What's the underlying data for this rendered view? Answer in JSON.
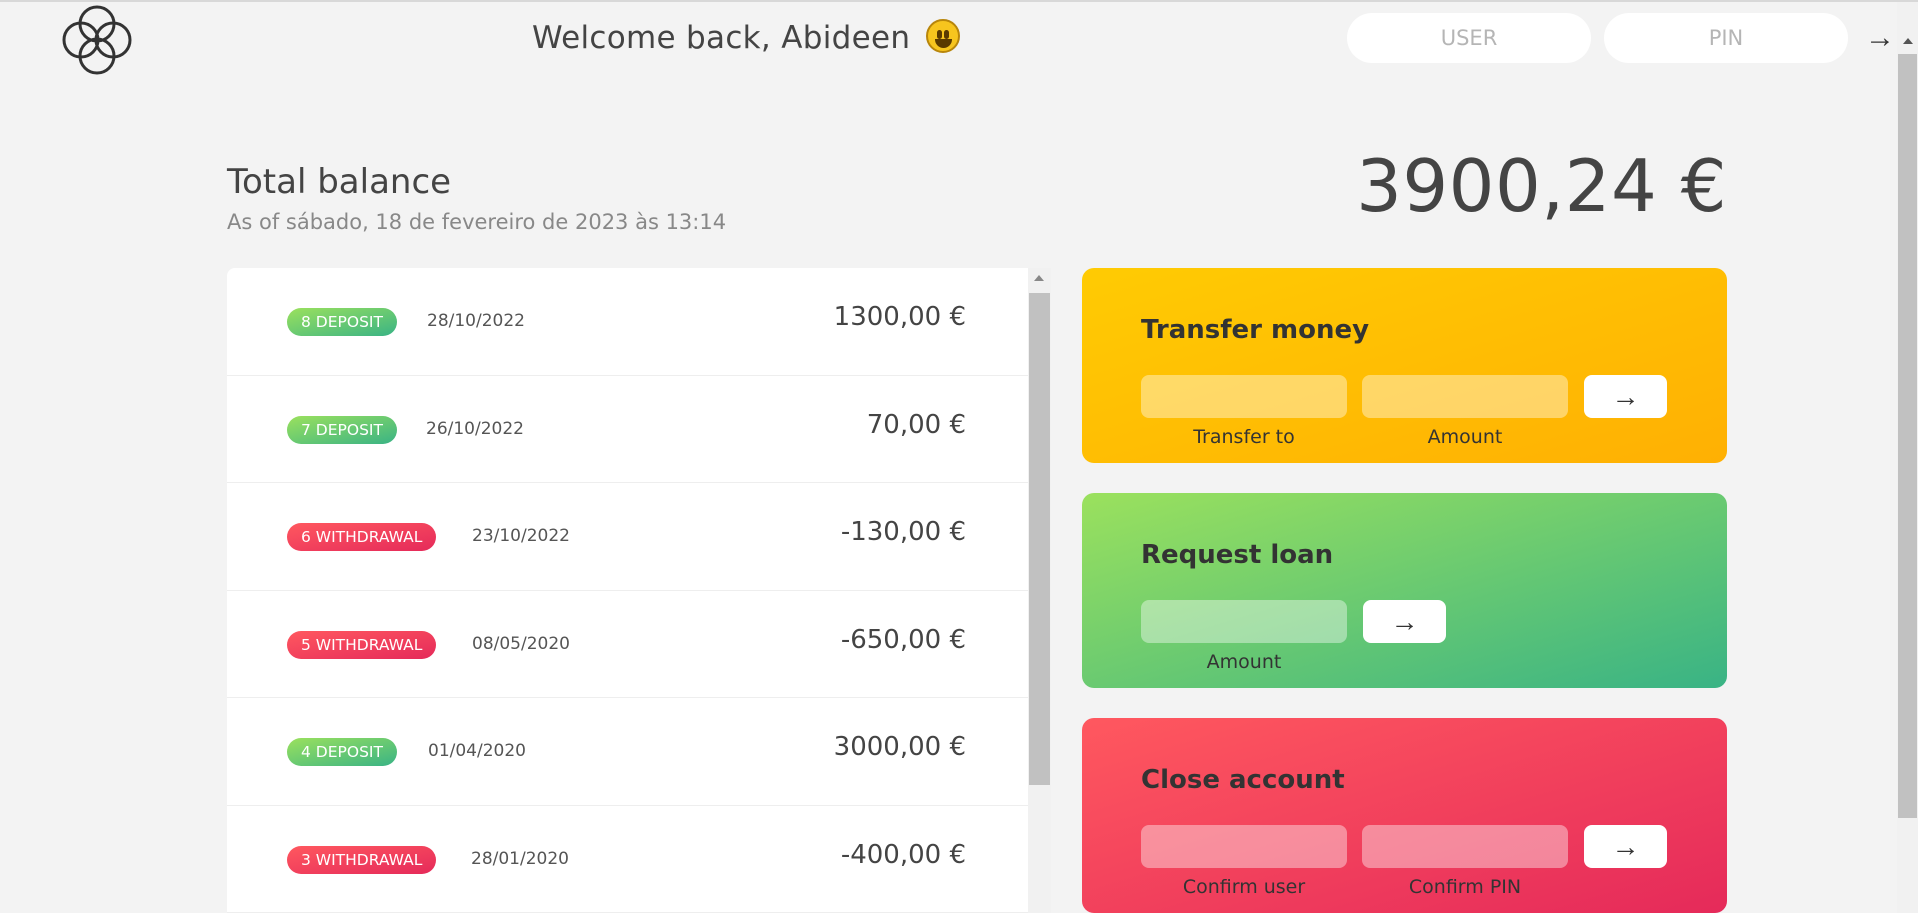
{
  "nav": {
    "welcome": "Welcome back, Abideen",
    "user_placeholder": "USER",
    "pin_placeholder": "PIN",
    "login_arrow": "→"
  },
  "balance": {
    "label": "Total balance",
    "date": "As of sábado, 18 de fevereiro de 2023 às 13:14",
    "value": "3900,24 €"
  },
  "movements": [
    {
      "type_label": "8 DEPOSIT",
      "kind": "deposit",
      "date": "28/10/2022",
      "value": "1300,00 €"
    },
    {
      "type_label": "7 DEPOSIT",
      "kind": "deposit",
      "date": "26/10/2022",
      "value": "70,00 €"
    },
    {
      "type_label": "6 WITHDRAWAL",
      "kind": "withdrawal",
      "date": "23/10/2022",
      "value": "-130,00 €"
    },
    {
      "type_label": "5 WITHDRAWAL",
      "kind": "withdrawal",
      "date": "08/05/2020",
      "value": "-650,00 €"
    },
    {
      "type_label": "4 DEPOSIT",
      "kind": "deposit",
      "date": "01/04/2020",
      "value": "3000,00 €"
    },
    {
      "type_label": "3 WITHDRAWAL",
      "kind": "withdrawal",
      "date": "28/01/2020",
      "value": "-400,00 €"
    }
  ],
  "operations": {
    "transfer": {
      "title": "Transfer money",
      "label_a": "Transfer to",
      "label_b": "Amount",
      "button": "→"
    },
    "loan": {
      "title": "Request loan",
      "label_a": "Amount",
      "button": "→"
    },
    "close": {
      "title": "Close account",
      "label_a": "Confirm user",
      "label_b": "Confirm PIN",
      "button": "→"
    }
  },
  "colors": {
    "deposit": "#39b385",
    "withdrawal": "#e52a5a",
    "transfer": "#ffb003",
    "background": "#f3f3f3"
  },
  "icons": {
    "logo": "four-rings-logo-icon",
    "emoji": "grinning-face-emoji-icon"
  }
}
